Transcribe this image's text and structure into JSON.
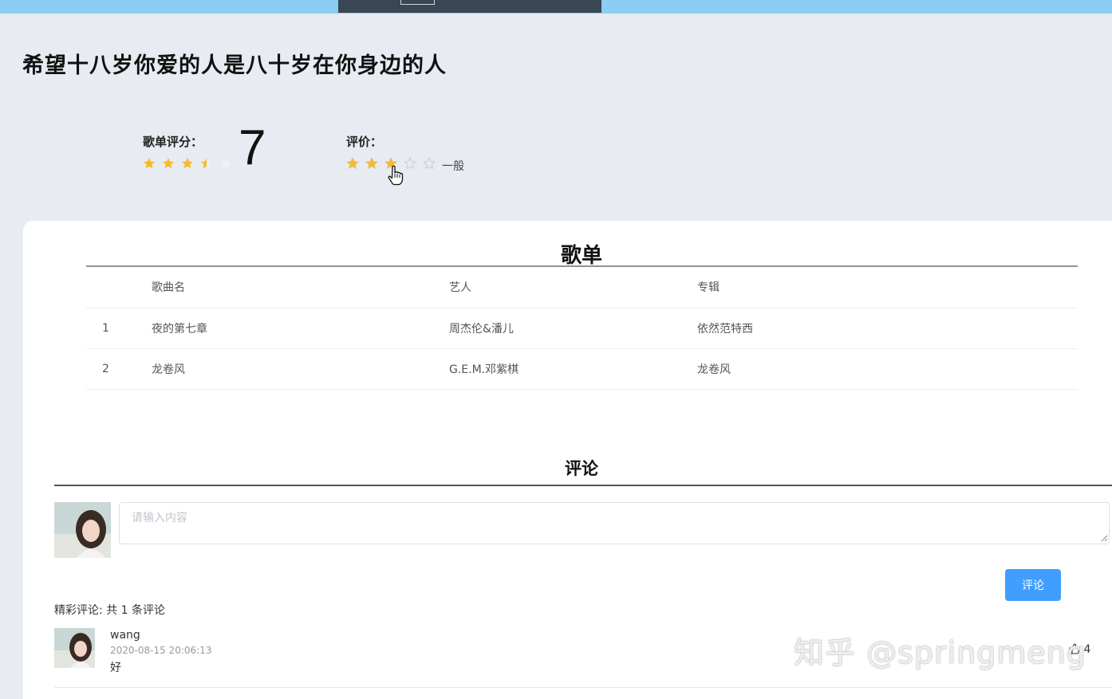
{
  "page": {
    "title": "希望十八岁你爱的人是八十岁在你身边的人"
  },
  "rating": {
    "label": "歌单评分：",
    "score": "7",
    "score_stars_value": 3.5,
    "score_stars_max": 5
  },
  "user_rating": {
    "label": "评价：",
    "value": 3,
    "max": 5,
    "text": "一般"
  },
  "songlist": {
    "title": "歌单",
    "columns": [
      "",
      "歌曲名",
      "艺人",
      "专辑"
    ],
    "rows": [
      {
        "index": "1",
        "name": "夜的第七章",
        "artist": "周杰伦&潘儿",
        "album": "依然范特西"
      },
      {
        "index": "2",
        "name": "龙卷风",
        "artist": "G.E.M.邓紫棋",
        "album": "龙卷风"
      }
    ]
  },
  "comments": {
    "title": "评论",
    "input_placeholder": "请输入内容",
    "submit_label": "评论",
    "count_text": "精彩评论: 共 1 条评论",
    "items": [
      {
        "user": "wang",
        "time": "2020-08-15 20:06:13",
        "text": "好",
        "likes": "4"
      }
    ]
  },
  "watermark": "知乎 @springmeng",
  "colors": {
    "star_active": "#f7ba2a",
    "star_inactive": "#c6d1de",
    "primary": "#409eff",
    "topbar": "#8ccdf3"
  }
}
